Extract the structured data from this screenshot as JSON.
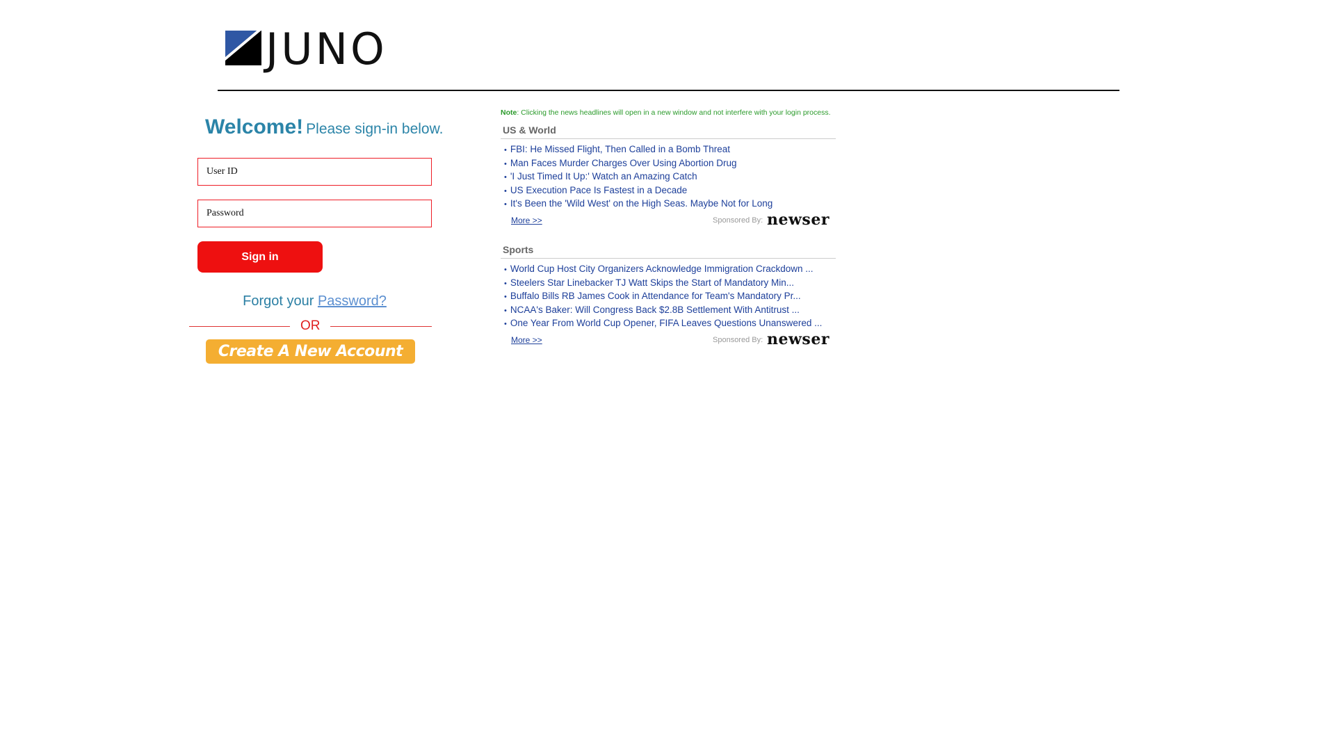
{
  "logo": {
    "text": "JUNO"
  },
  "welcome": {
    "title": "Welcome!",
    "subtitle": "Please sign-in below."
  },
  "form": {
    "user_placeholder": "User ID",
    "password_placeholder": "Password",
    "signin_label": "Sign in",
    "forgot_prefix": "Forgot your",
    "forgot_link": "Password?",
    "or_label": "OR",
    "create_label": "Create A New Account"
  },
  "news": {
    "note_label": "Note",
    "note_text": ": Clicking the news headlines will open in a new window and not interfere with your login process.",
    "sections": [
      {
        "title": "US & World",
        "items": [
          "FBI: He Missed Flight, Then Called in a Bomb Threat",
          "Man Faces Murder Charges Over Using Abortion Drug",
          "'I Just Timed It Up:' Watch an Amazing Catch",
          "US Execution Pace Is Fastest in a Decade",
          "It's Been the 'Wild West' on the High Seas. Maybe Not for Long"
        ],
        "more": "More >>",
        "sponsored": "Sponsored By:",
        "sponsor": "newser"
      },
      {
        "title": "Sports",
        "items": [
          "World Cup Host City Organizers Acknowledge Immigration Crackdown ...",
          "Steelers Star Linebacker TJ Watt Skips the Start of Mandatory Min...",
          "Buffalo Bills RB James Cook in Attendance for Team's Mandatory Pr...",
          "NCAA's Baker: Will Congress Back $2.8B Settlement With Antitrust ...",
          "One Year From World Cup Opener, FIFA Leaves Questions Unanswered ..."
        ],
        "more": "More >>",
        "sponsored": "Sponsored By:",
        "sponsor": "newser"
      }
    ]
  }
}
